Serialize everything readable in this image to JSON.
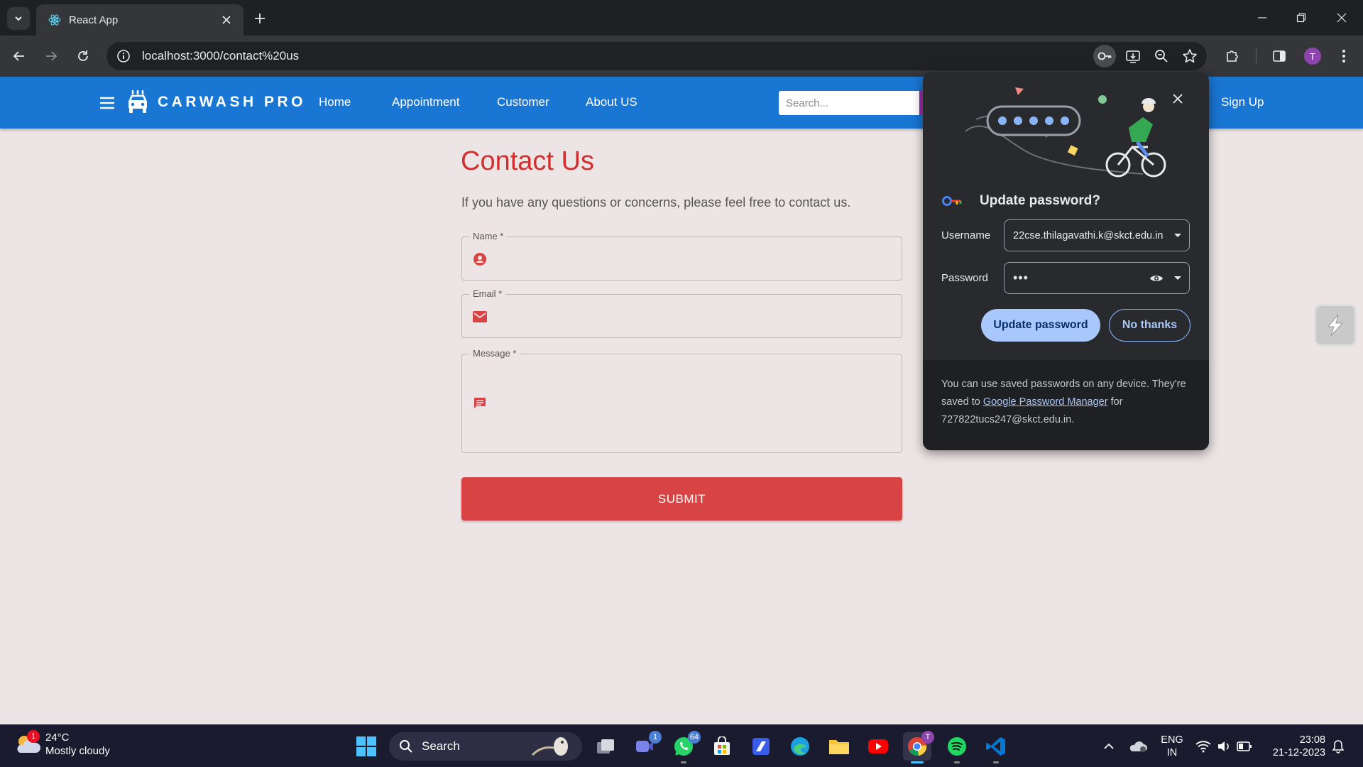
{
  "browser": {
    "tab_title": "React App",
    "url": "localhost:3000/contact%20us",
    "profile_initial": "T"
  },
  "appbar": {
    "brand": "CARWASH PRO",
    "nav": [
      "Home",
      "Appointment",
      "Customer",
      "About US"
    ],
    "search_placeholder": "Search...",
    "signup": "Sign Up"
  },
  "contact": {
    "title": "Contact Us",
    "subtitle": "If you have any questions or concerns, please feel free to contact us.",
    "name_label": "Name *",
    "email_label": "Email *",
    "message_label": "Message *",
    "submit": "SUBMIT"
  },
  "password_bubble": {
    "title": "Update password?",
    "username_label": "Username",
    "username_value": "22cse.thilagavathi.k@skct.edu.in",
    "password_label": "Password",
    "password_value": "•••",
    "update_button": "Update password",
    "no_thanks_button": "No thanks",
    "footer_text_1": "You can use saved passwords on any device. They're saved to ",
    "footer_link": "Google Password Manager",
    "footer_text_2": " for 727822tucs247@skct.edu.in."
  },
  "taskbar": {
    "weather_temp": "24°C",
    "weather_desc": "Mostly cloudy",
    "weather_badge": "1",
    "search_label": "Search",
    "teams_badge": "1",
    "whatsapp_badge": "64",
    "chrome_badge": "T",
    "lang_1": "ENG",
    "lang_2": "IN",
    "time": "23:08",
    "date": "21-12-2023"
  }
}
